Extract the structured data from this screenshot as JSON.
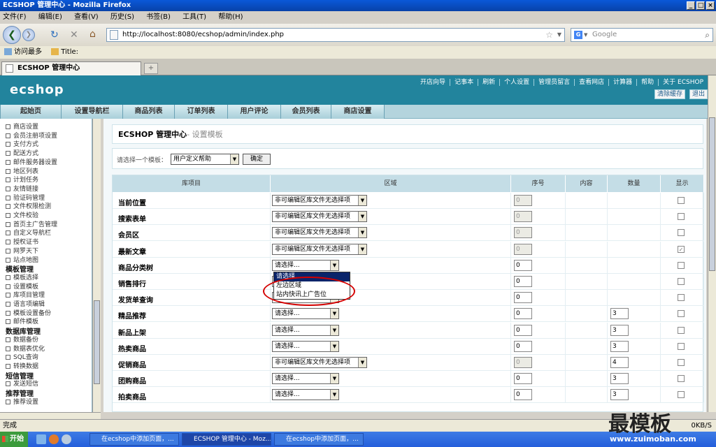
{
  "window": {
    "title": "ECSHOP 管理中心 - Mozilla Firefox"
  },
  "menu": [
    "文件(F)",
    "编辑(E)",
    "查看(V)",
    "历史(S)",
    "书签(B)",
    "工具(T)",
    "帮助(H)"
  ],
  "nav": {
    "url": "http://localhost:8080/ecshop/admin/index.php",
    "search_placeholder": "Google"
  },
  "bookmarks": [
    "访问最多",
    "Title:"
  ],
  "tab": {
    "title": "ECSHOP 管理中心"
  },
  "ecshop": {
    "logo": "ecshop",
    "toplinks": [
      "开店向导",
      "记事本",
      "刷新",
      "个人设置",
      "管理员留言",
      "查看网店",
      "计算器",
      "帮助",
      "关于 ECSHOP"
    ],
    "clear_cache": "清除缓存",
    "logout": "退出",
    "mainmenu": [
      "起始页",
      "设置导航栏",
      "商品列表",
      "订单列表",
      "用户评论",
      "会员列表",
      "商店设置"
    ]
  },
  "sidebar": [
    {
      "type": "item",
      "label": "商店设置"
    },
    {
      "type": "item",
      "label": "会员注册项设置"
    },
    {
      "type": "item",
      "label": "支付方式"
    },
    {
      "type": "item",
      "label": "配送方式"
    },
    {
      "type": "item",
      "label": "邮件服务器设置"
    },
    {
      "type": "item",
      "label": "地区列表"
    },
    {
      "type": "item",
      "label": "计划任务"
    },
    {
      "type": "item",
      "label": "友情链接"
    },
    {
      "type": "item",
      "label": "验证码管理"
    },
    {
      "type": "item",
      "label": "文件权限检测"
    },
    {
      "type": "item",
      "label": "文件校验"
    },
    {
      "type": "item",
      "label": "首页主广告管理"
    },
    {
      "type": "item",
      "label": "自定义导航栏"
    },
    {
      "type": "item",
      "label": "授权证书"
    },
    {
      "type": "item",
      "label": "网罗天下"
    },
    {
      "type": "item",
      "label": "站点地图"
    },
    {
      "type": "group",
      "label": "模板管理"
    },
    {
      "type": "item",
      "label": "模板选择"
    },
    {
      "type": "item",
      "label": "设置模板"
    },
    {
      "type": "item",
      "label": "库项目管理"
    },
    {
      "type": "item",
      "label": "语言项编辑"
    },
    {
      "type": "item",
      "label": "模板设置备份"
    },
    {
      "type": "item",
      "label": "邮件模板"
    },
    {
      "type": "group",
      "label": "数据库管理"
    },
    {
      "type": "item",
      "label": "数据备份"
    },
    {
      "type": "item",
      "label": "数据表优化"
    },
    {
      "type": "item",
      "label": "SQL查询"
    },
    {
      "type": "item",
      "label": "转换数据"
    },
    {
      "type": "group",
      "label": "短信管理"
    },
    {
      "type": "item",
      "label": "发送短信"
    },
    {
      "type": "group",
      "label": "推荐管理"
    },
    {
      "type": "item",
      "label": "推荐设置"
    }
  ],
  "page": {
    "heading": "ECSHOP 管理中心",
    "subheading": "- 设置模板",
    "template_label": "请选择一个模板：",
    "template_value": "用户定义帮助",
    "ok_button": "确定"
  },
  "table": {
    "headers": [
      "库项目",
      "区域",
      "序号",
      "内容",
      "数量",
      "显示"
    ],
    "rows": [
      {
        "name": "当前位置",
        "region": "非可编辑区库文件无选择项",
        "seq": "0",
        "seq_disabled": true,
        "qty": "",
        "show": false
      },
      {
        "name": "搜索表单",
        "region": "非可编辑区库文件无选择项",
        "seq": "0",
        "seq_disabled": true,
        "qty": "",
        "show": false
      },
      {
        "name": "会员区",
        "region": "非可编辑区库文件无选择项",
        "seq": "0",
        "seq_disabled": true,
        "qty": "",
        "show": false
      },
      {
        "name": "最新文章",
        "region": "非可编辑区库文件无选择项",
        "seq": "0",
        "seq_disabled": true,
        "qty": "",
        "show": true
      },
      {
        "name": "商品分类树",
        "region": "请选择...",
        "seq": "0",
        "seq_disabled": false,
        "qty": "",
        "show": false
      },
      {
        "name": "销售排行",
        "region": "请选择...",
        "seq": "0",
        "seq_disabled": false,
        "qty": "",
        "show": false
      },
      {
        "name": "发货单查询",
        "region": "请选择...",
        "seq": "0",
        "seq_disabled": false,
        "qty": "",
        "show": false
      },
      {
        "name": "精品推荐",
        "region": "请选择...",
        "seq": "0",
        "seq_disabled": false,
        "qty": "3",
        "show": false
      },
      {
        "name": "新品上架",
        "region": "请选择...",
        "seq": "0",
        "seq_disabled": false,
        "qty": "3",
        "show": false
      },
      {
        "name": "热卖商品",
        "region": "请选择...",
        "seq": "0",
        "seq_disabled": false,
        "qty": "3",
        "show": false
      },
      {
        "name": "促销商品",
        "region": "非可编辑区库文件无选择项",
        "seq": "0",
        "seq_disabled": true,
        "qty": "4",
        "show": false
      },
      {
        "name": "团购商品",
        "region": "请选择...",
        "seq": "0",
        "seq_disabled": false,
        "qty": "3",
        "show": false
      },
      {
        "name": "拍卖商品",
        "region": "请选择...",
        "seq": "0",
        "seq_disabled": false,
        "qty": "3",
        "show": false
      }
    ]
  },
  "dropdown": {
    "options": [
      "请选择...",
      "左边区域",
      "站内快讯上广告位"
    ]
  },
  "status": {
    "text": "完成",
    "speed": "0KB/S"
  },
  "taskbar": {
    "start": "开始",
    "tasks": [
      "在ecshop中添加页面，...",
      "ECSHOP 管理中心 - Moz...",
      "在ecshop中添加页面，..."
    ]
  },
  "watermark": {
    "text": "最模板",
    "url": "www.zuimoban.com"
  }
}
